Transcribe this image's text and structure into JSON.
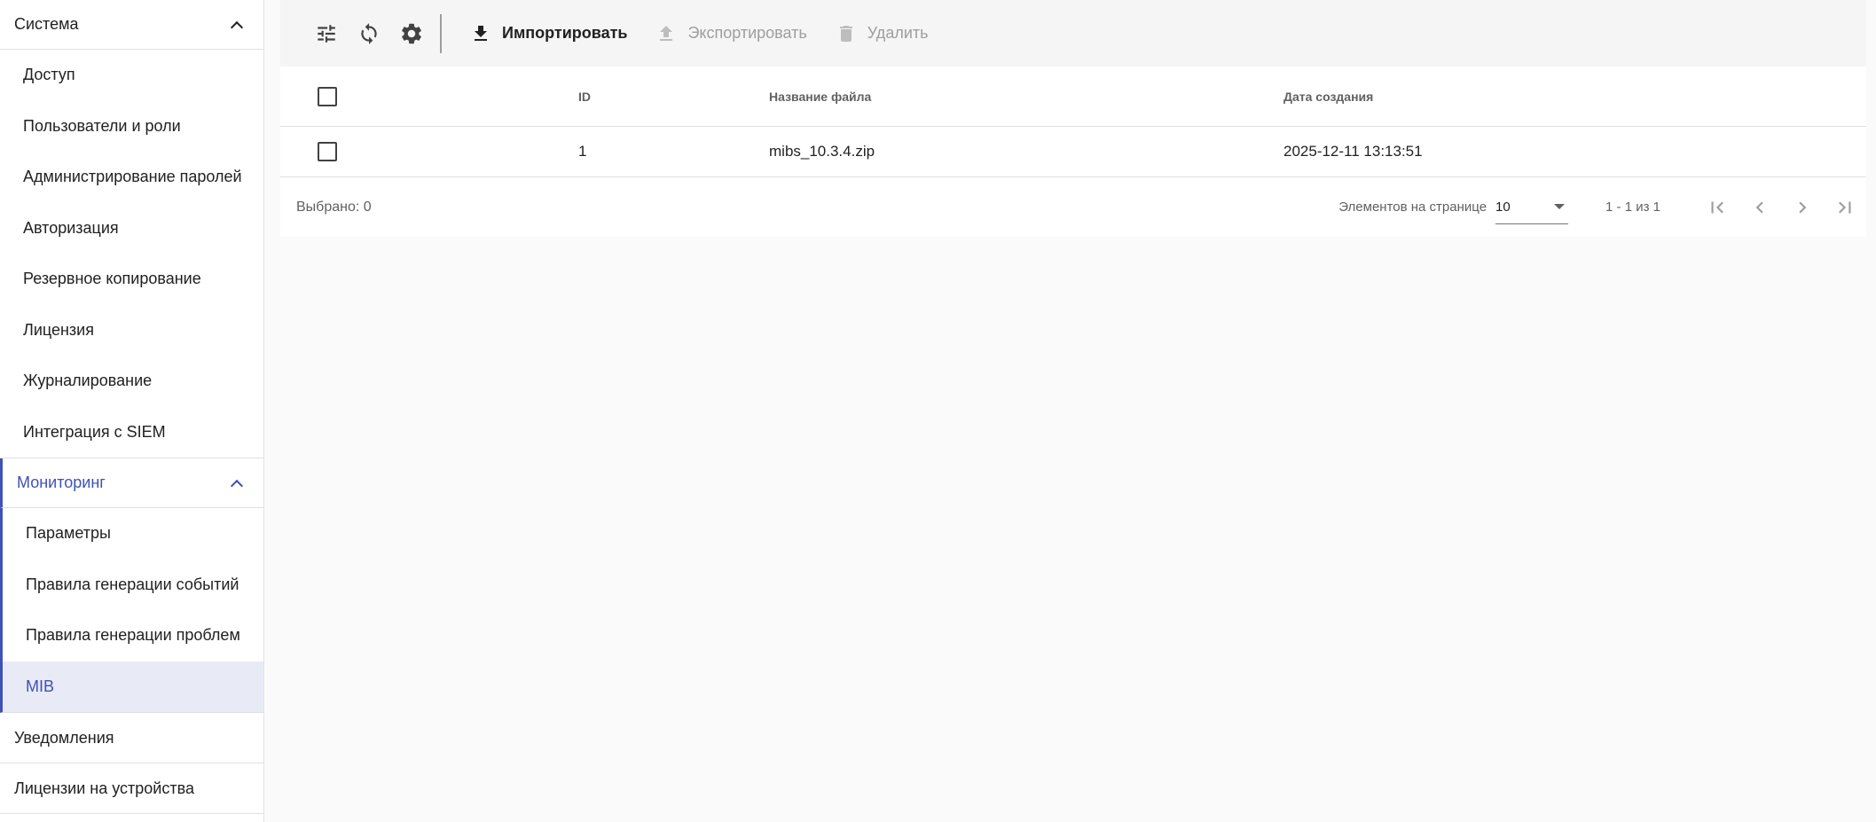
{
  "sidebar": {
    "system": {
      "label": "Система",
      "items": [
        "Доступ",
        "Пользователи и роли",
        "Администрирование паролей",
        "Авторизация",
        "Резервное копирование",
        "Лицензия",
        "Журналирование",
        "Интеграция с SIEM"
      ]
    },
    "monitoring": {
      "label": "Мониторинг",
      "items": [
        "Параметры",
        "Правила генерации событий",
        "Правила генерации проблем",
        "MIB"
      ],
      "selected_index": 3
    },
    "notifications": {
      "label": "Уведомления"
    },
    "device_licenses": {
      "label": "Лицензии на устройства"
    }
  },
  "toolbar": {
    "icons": [
      "tune-icon",
      "sync-icon",
      "gear-icon"
    ],
    "import_label": "Импортировать",
    "export_label": "Экспортировать",
    "delete_label": "Удалить"
  },
  "table": {
    "columns": [
      "ID",
      "Название файла",
      "Дата создания"
    ],
    "rows": [
      {
        "id": "1",
        "name": "mibs_10.3.4.zip",
        "date": "2025-12-11 13:13:51"
      }
    ]
  },
  "footer": {
    "selected": "Выбрано: 0",
    "per_page_label": "Элементов на странице",
    "per_page_value": "10",
    "range": "1 - 1 из 1"
  },
  "colors": {
    "accent": "#3f51b5",
    "selected_bg": "#e8eaf6",
    "disabled": "#9e9e9e"
  }
}
